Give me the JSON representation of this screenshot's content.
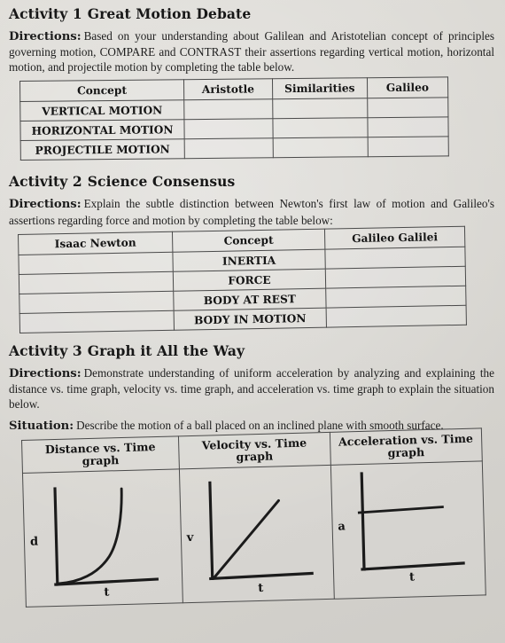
{
  "activity1": {
    "heading_number": "Activity 1",
    "heading_title": "Great Motion Debate",
    "directions_label": "Directions:",
    "directions_text": "Based on your understanding about Galilean and Aristotelian concept of principles governing motion, COMPARE and CONTRAST their assertions regarding vertical motion, horizontal motion, and projectile motion by completing the table below.",
    "table": {
      "headers": [
        "Concept",
        "Aristotle",
        "Similarities",
        "Galileo"
      ],
      "rows": [
        [
          "VERTICAL MOTION",
          "",
          "",
          ""
        ],
        [
          "HORIZONTAL MOTION",
          "",
          "",
          ""
        ],
        [
          "PROJECTILE MOTION",
          "",
          "",
          ""
        ]
      ]
    }
  },
  "activity2": {
    "heading_number": "Activity 2",
    "heading_title": "Science Consensus",
    "directions_label": "Directions:",
    "directions_text": "Explain the subtle distinction between Newton's first law of motion and Galileo's assertions regarding force and motion by completing the table below:",
    "table": {
      "headers": [
        "Isaac Newton",
        "Concept",
        "Galileo Galilei"
      ],
      "rows": [
        [
          "",
          "INERTIA",
          ""
        ],
        [
          "",
          "FORCE",
          ""
        ],
        [
          "",
          "BODY AT REST",
          ""
        ],
        [
          "",
          "BODY IN MOTION",
          ""
        ]
      ]
    }
  },
  "activity3": {
    "heading_number": "Activity 3",
    "heading_title": "Graph it All the Way",
    "directions_label": "Directions:",
    "directions_text": "Demonstrate understanding of uniform acceleration by analyzing and explaining the distance vs. time graph, velocity vs. time graph, and acceleration vs. time graph to explain the situation below.",
    "situation_label": "Situation:",
    "situation_text": "Describe the motion of a ball placed on an inclined plane with smooth surface.",
    "table": {
      "headers": [
        "Distance vs. Time graph",
        "Velocity vs. Time graph",
        "Acceleration vs. Time graph"
      ]
    }
  },
  "chart_data": [
    {
      "type": "line",
      "title": "Distance vs. Time graph",
      "xlabel": "t",
      "ylabel": "d",
      "shape": "increasing-concave-up",
      "description": "Curve starts flat at origin and rises steeply; distance increases with the square of time (uniform acceleration).",
      "x": [
        0,
        0.1,
        0.2,
        0.3,
        0.4,
        0.5,
        0.6,
        0.7,
        0.8,
        0.9,
        1.0
      ],
      "y": [
        0,
        0.01,
        0.04,
        0.09,
        0.16,
        0.25,
        0.36,
        0.49,
        0.64,
        0.81,
        1.0
      ],
      "grid": false,
      "legend": "none"
    },
    {
      "type": "line",
      "title": "Velocity vs. Time graph",
      "xlabel": "t",
      "ylabel": "v",
      "shape": "linear-increasing",
      "description": "Straight line from the origin with constant positive slope; velocity increases uniformly with time.",
      "x": [
        0,
        0.25,
        0.5,
        0.75,
        1.0
      ],
      "y": [
        0,
        0.25,
        0.5,
        0.75,
        1.0
      ],
      "grid": false,
      "legend": "none"
    },
    {
      "type": "line",
      "title": "Acceleration vs. Time graph",
      "xlabel": "t",
      "ylabel": "a",
      "shape": "constant",
      "description": "Horizontal line at a constant positive value; acceleration does not change with time.",
      "x": [
        0,
        0.25,
        0.5,
        0.75,
        1.0
      ],
      "y": [
        0.6,
        0.6,
        0.6,
        0.6,
        0.6
      ],
      "grid": false,
      "legend": "none"
    }
  ],
  "colors": {
    "paper": "#d9d7d2",
    "ink": "#1a1a1a",
    "rule": "#4a4a4a"
  }
}
